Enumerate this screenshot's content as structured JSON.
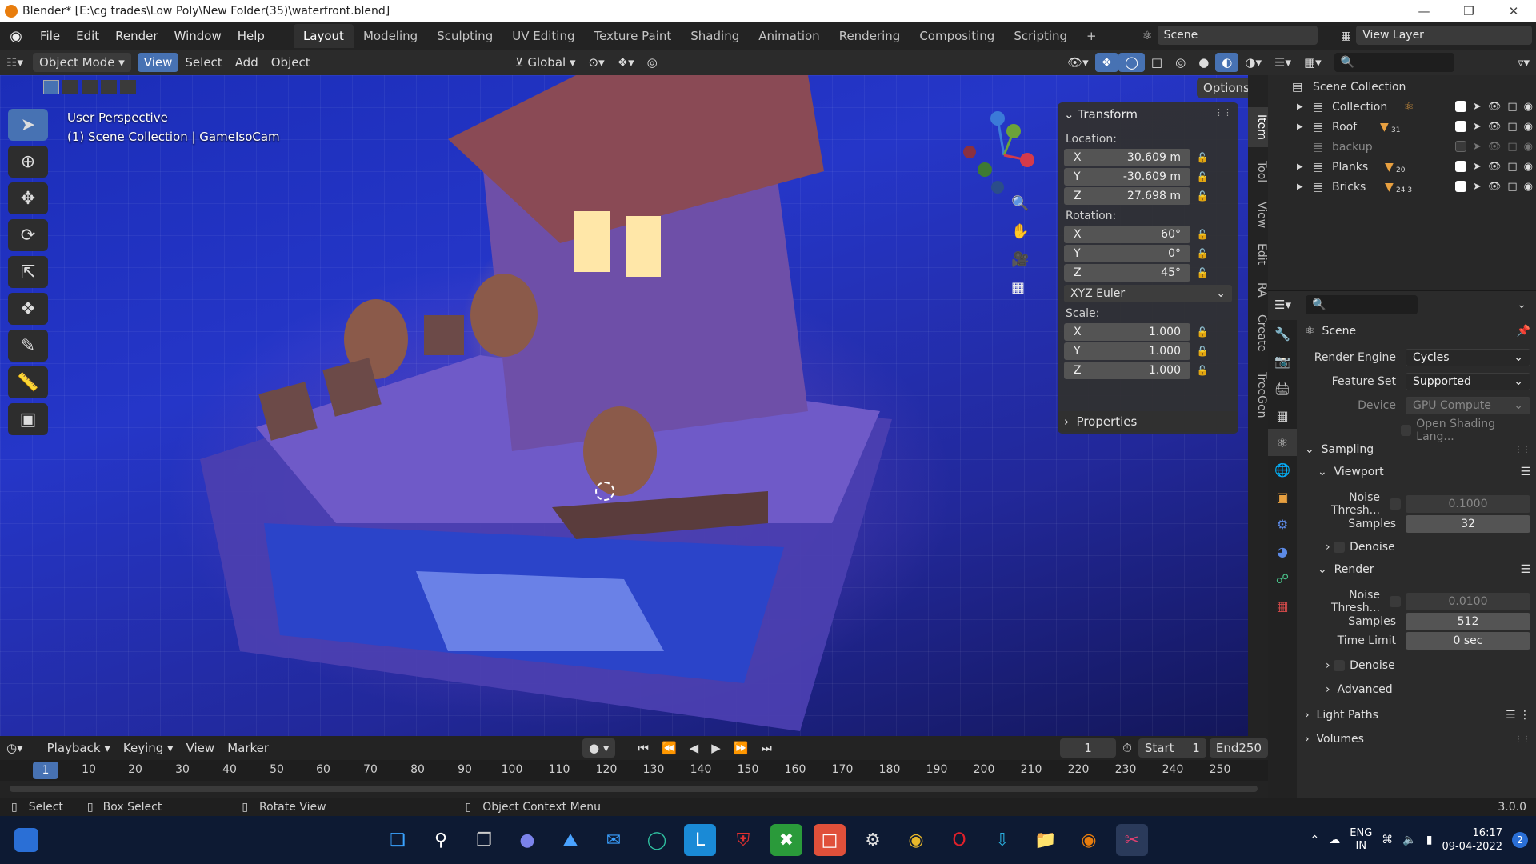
{
  "titlebar": {
    "title": "Blender* [E:\\cg trades\\Low Poly\\New Folder(35)\\waterfront.blend]",
    "minimize": "—",
    "maximize": "❐",
    "close": "✕"
  },
  "menu": [
    "File",
    "Edit",
    "Render",
    "Window",
    "Help"
  ],
  "workspaces": [
    "Layout",
    "Modeling",
    "Sculpting",
    "UV Editing",
    "Texture Paint",
    "Shading",
    "Animation",
    "Rendering",
    "Compositing",
    "Scripting"
  ],
  "active_workspace": "Layout",
  "add_workspace": "+",
  "scene_field": "Scene",
  "view_layer_field": "View Layer",
  "viewport_header": {
    "mode": "Object Mode",
    "menus": [
      "View",
      "Select",
      "Add",
      "Object"
    ],
    "orientation": "Global",
    "options": "Options"
  },
  "viewport": {
    "perspective": "User Perspective",
    "collection_info": "(1) Scene Collection | GameIsoCam"
  },
  "transform": {
    "title": "Transform",
    "location_label": "Location:",
    "location": {
      "x": "30.609 m",
      "y": "-30.609 m",
      "z": "27.698 m"
    },
    "rotation_label": "Rotation:",
    "rotation": {
      "x": "60°",
      "y": "0°",
      "z": "45°"
    },
    "rotation_mode": "XYZ Euler",
    "scale_label": "Scale:",
    "scale": {
      "x": "1.000",
      "y": "1.000",
      "z": "1.000"
    },
    "axis": {
      "x": "X",
      "y": "Y",
      "z": "Z"
    },
    "properties": "Properties"
  },
  "side_tabs": [
    "Item",
    "Tool",
    "View",
    "Edit",
    "RA",
    "Create",
    "TreeGen"
  ],
  "outliner": {
    "root": "Scene Collection",
    "items": [
      {
        "name": "Collection",
        "badge": ""
      },
      {
        "name": "Roof",
        "badge": "31"
      },
      {
        "name": "backup",
        "badge": ""
      },
      {
        "name": "Planks",
        "badge": "20"
      },
      {
        "name": "Bricks",
        "badge": "24 3"
      }
    ]
  },
  "properties": {
    "context": "Scene",
    "render_engine_label": "Render Engine",
    "render_engine": "Cycles",
    "feature_set_label": "Feature Set",
    "feature_set": "Supported",
    "device_label": "Device",
    "device": "GPU Compute",
    "osl": "Open Shading Lang...",
    "sampling": "Sampling",
    "viewport": "Viewport",
    "noise_label": "Noise Thresh...",
    "viewport_noise": "0.1000",
    "samples_label": "Samples",
    "viewport_samples": "32",
    "denoise": "Denoise",
    "render": "Render",
    "render_noise": "0.0100",
    "render_samples": "512",
    "time_limit_label": "Time Limit",
    "time_limit": "0 sec",
    "advanced": "Advanced",
    "light_paths": "Light Paths",
    "volumes": "Volumes"
  },
  "timeline": {
    "menus": [
      "Playback",
      "Keying",
      "View",
      "Marker"
    ],
    "current_frame": "1",
    "start_label": "Start",
    "start": "1",
    "end_label": "End",
    "end": "250",
    "ruler": [
      "10",
      "20",
      "30",
      "40",
      "50",
      "60",
      "70",
      "80",
      "90",
      "100",
      "110",
      "120",
      "130",
      "140",
      "150",
      "160",
      "170",
      "180",
      "190",
      "200",
      "210",
      "220",
      "230",
      "240",
      "250"
    ]
  },
  "statusbar": {
    "select": "Select",
    "box_select": "Box Select",
    "rotate": "Rotate View",
    "context_menu": "Object Context Menu",
    "version": "3.0.0"
  },
  "taskbar": {
    "lang": "ENG",
    "region": "IN",
    "time": "16:17",
    "date": "09-04-2022",
    "notif": "2"
  }
}
